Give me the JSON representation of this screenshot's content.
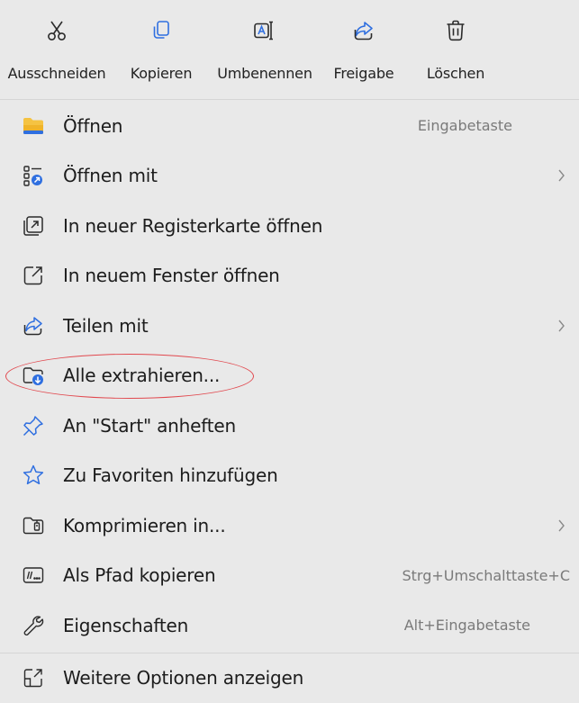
{
  "toolbar": {
    "cut_label": "Ausschneiden",
    "copy_label": "Kopieren",
    "rename_label": "Umbenennen",
    "share_label": "Freigabe",
    "delete_label": "Löschen"
  },
  "menu": {
    "items": [
      {
        "label": "Öffnen",
        "shortcut": "Eingabetaste",
        "icon": "folder-icon"
      },
      {
        "label": "Öffnen mit",
        "icon": "open-with-icon"
      },
      {
        "label": "In neuer Registerkarte öffnen",
        "icon": "new-tab-icon"
      },
      {
        "label": "In neuem Fenster öffnen",
        "icon": "new-window-icon"
      },
      {
        "label": "Teilen mit",
        "icon": "share-icon"
      },
      {
        "label": "Alle extrahieren...",
        "icon": "extract-icon"
      },
      {
        "label": "An \"Start\" anheften",
        "icon": "pin-icon"
      },
      {
        "label": "Zu Favoriten hinzufügen",
        "icon": "star-icon"
      },
      {
        "label": "Komprimieren in...",
        "icon": "compress-icon"
      },
      {
        "label": "Als Pfad kopieren",
        "shortcut": "Strg+Umschalttaste+C",
        "icon": "copy-path-icon"
      },
      {
        "label": "Eigenschaften",
        "shortcut": "Alt+Eingabetaste",
        "icon": "wrench-icon"
      }
    ],
    "more_options_label": "Weitere Optionen anzeigen"
  },
  "colors": {
    "background": "#e9e9e9",
    "accent_blue": "#2f6fe0",
    "folder_yellow": "#f5c342",
    "highlight_red": "#e1494f"
  }
}
